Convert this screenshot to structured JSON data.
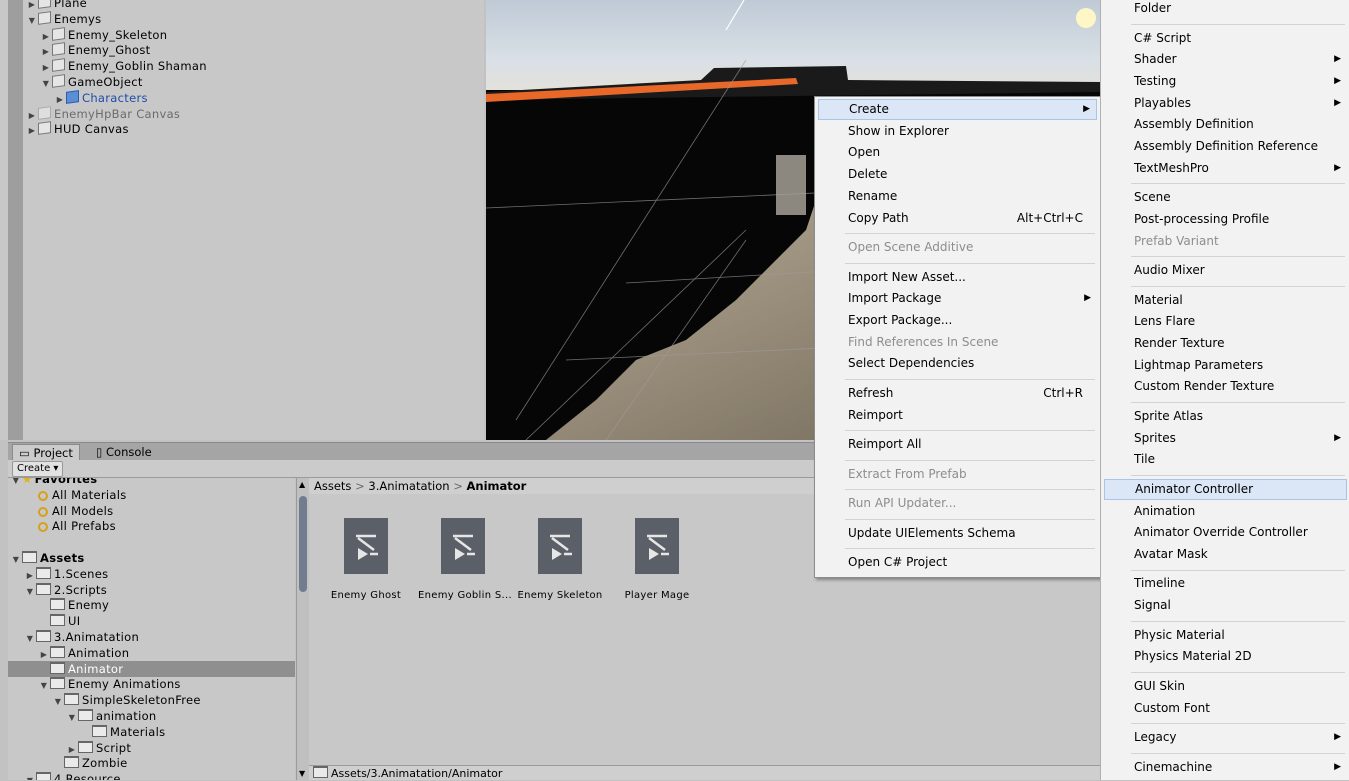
{
  "hierarchy": {
    "items": [
      {
        "label": "Plane",
        "indent": 1,
        "arrow": "right",
        "style": "normal"
      },
      {
        "label": "Enemys",
        "indent": 1,
        "arrow": "down",
        "style": "normal"
      },
      {
        "label": "Enemy_Skeleton",
        "indent": 2,
        "arrow": "right",
        "style": "normal"
      },
      {
        "label": "Enemy_Ghost",
        "indent": 2,
        "arrow": "right",
        "style": "normal"
      },
      {
        "label": "Enemy_Goblin Shaman",
        "indent": 2,
        "arrow": "right",
        "style": "normal"
      },
      {
        "label": "GameObject",
        "indent": 2,
        "arrow": "down",
        "style": "normal"
      },
      {
        "label": "Characters",
        "indent": 3,
        "arrow": "right",
        "style": "prefab"
      },
      {
        "label": "EnemyHpBar Canvas",
        "indent": 1,
        "arrow": "right",
        "style": "inactive"
      },
      {
        "label": "HUD Canvas",
        "indent": 1,
        "arrow": "right",
        "style": "normal"
      }
    ]
  },
  "project": {
    "tabs": [
      {
        "label": "Project",
        "icon": "folder-icon"
      },
      {
        "label": "Console",
        "icon": "console-icon"
      }
    ],
    "create_label": "Create ▾",
    "tree": {
      "favorites_label": "Favorites",
      "favorites": [
        "All Materials",
        "All Models",
        "All Prefabs"
      ],
      "assets_label": "Assets",
      "items": [
        {
          "label": "1.Scenes",
          "indent": 1,
          "arrow": "right"
        },
        {
          "label": "2.Scripts",
          "indent": 1,
          "arrow": "down"
        },
        {
          "label": "Enemy",
          "indent": 2,
          "arrow": ""
        },
        {
          "label": "UI",
          "indent": 2,
          "arrow": ""
        },
        {
          "label": "3.Animatation",
          "indent": 1,
          "arrow": "down"
        },
        {
          "label": "Animation",
          "indent": 2,
          "arrow": "right"
        },
        {
          "label": "Animator",
          "indent": 2,
          "arrow": "",
          "selected": true
        },
        {
          "label": "Enemy Animations",
          "indent": 2,
          "arrow": "down"
        },
        {
          "label": "SimpleSkeletonFree",
          "indent": 3,
          "arrow": "down"
        },
        {
          "label": "animation",
          "indent": 4,
          "arrow": "down"
        },
        {
          "label": "Materials",
          "indent": 5,
          "arrow": ""
        },
        {
          "label": "Script",
          "indent": 4,
          "arrow": "right"
        },
        {
          "label": "Zombie",
          "indent": 3,
          "arrow": ""
        },
        {
          "label": "4.Resource",
          "indent": 1,
          "arrow": "down"
        }
      ]
    },
    "breadcrumb": {
      "part1": "Assets",
      "part2": "3.Animatation",
      "part3": "Animator",
      "sep": ">"
    },
    "assets": [
      "Enemy Ghost",
      "Enemy Goblin S...",
      "Enemy Skeleton",
      "Player Mage"
    ],
    "path": "Assets/3.Animatation/Animator"
  },
  "context_menu": {
    "items": [
      {
        "label": "Create",
        "submenu": true,
        "highlight": true
      },
      {
        "label": "Show in Explorer"
      },
      {
        "label": "Open"
      },
      {
        "label": "Delete"
      },
      {
        "label": "Rename"
      },
      {
        "label": "Copy Path",
        "shortcut": "Alt+Ctrl+C"
      },
      {
        "sep": true
      },
      {
        "label": "Open Scene Additive",
        "disabled": true
      },
      {
        "sep": true
      },
      {
        "label": "Import New Asset..."
      },
      {
        "label": "Import Package",
        "submenu": true
      },
      {
        "label": "Export Package..."
      },
      {
        "label": "Find References In Scene",
        "disabled": true
      },
      {
        "label": "Select Dependencies"
      },
      {
        "sep": true
      },
      {
        "label": "Refresh",
        "shortcut": "Ctrl+R"
      },
      {
        "label": "Reimport"
      },
      {
        "sep": true
      },
      {
        "label": "Reimport All"
      },
      {
        "sep": true
      },
      {
        "label": "Extract From Prefab",
        "disabled": true
      },
      {
        "sep": true
      },
      {
        "label": "Run API Updater...",
        "disabled": true
      },
      {
        "sep": true
      },
      {
        "label": "Update UIElements Schema"
      },
      {
        "sep": true
      },
      {
        "label": "Open C# Project"
      }
    ]
  },
  "create_submenu": {
    "items": [
      {
        "label": "Folder"
      },
      {
        "sep": true
      },
      {
        "label": "C# Script"
      },
      {
        "label": "Shader",
        "submenu": true
      },
      {
        "label": "Testing",
        "submenu": true
      },
      {
        "label": "Playables",
        "submenu": true
      },
      {
        "label": "Assembly Definition"
      },
      {
        "label": "Assembly Definition Reference"
      },
      {
        "label": "TextMeshPro",
        "submenu": true
      },
      {
        "sep": true
      },
      {
        "label": "Scene"
      },
      {
        "label": "Post-processing Profile"
      },
      {
        "label": "Prefab Variant",
        "disabled": true
      },
      {
        "sep": true
      },
      {
        "label": "Audio Mixer"
      },
      {
        "sep": true
      },
      {
        "label": "Material"
      },
      {
        "label": "Lens Flare"
      },
      {
        "label": "Render Texture"
      },
      {
        "label": "Lightmap Parameters"
      },
      {
        "label": "Custom Render Texture"
      },
      {
        "sep": true
      },
      {
        "label": "Sprite Atlas"
      },
      {
        "label": "Sprites",
        "submenu": true
      },
      {
        "label": "Tile"
      },
      {
        "sep": true
      },
      {
        "label": "Animator Controller",
        "highlight": true
      },
      {
        "label": "Animation"
      },
      {
        "label": "Animator Override Controller"
      },
      {
        "label": "Avatar Mask"
      },
      {
        "sep": true
      },
      {
        "label": "Timeline"
      },
      {
        "label": "Signal"
      },
      {
        "sep": true
      },
      {
        "label": "Physic Material"
      },
      {
        "label": "Physics Material 2D"
      },
      {
        "sep": true
      },
      {
        "label": "GUI Skin"
      },
      {
        "label": "Custom Font"
      },
      {
        "sep": true
      },
      {
        "label": "Legacy",
        "submenu": true
      },
      {
        "sep": true
      },
      {
        "label": "Cinemachine",
        "submenu": true
      }
    ]
  },
  "colors": {
    "selection": "#8f8f8f",
    "menu_highlight": "#dbe7f6",
    "prefab_text": "#1f4da8",
    "scene_orange": "#e8682a"
  }
}
